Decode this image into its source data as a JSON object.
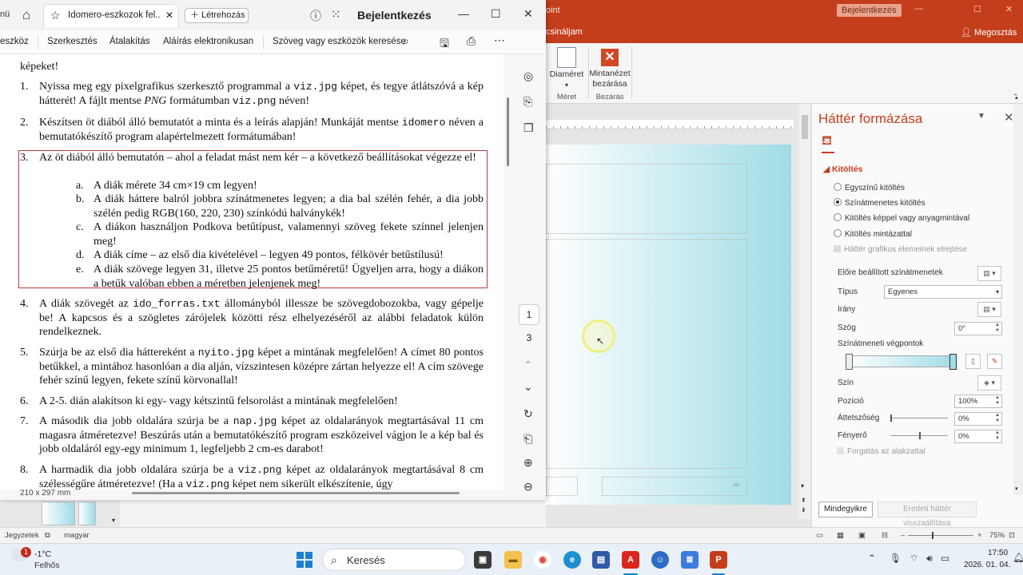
{
  "ppt": {
    "app_title_fragment": "oint",
    "signin_label": "Bejelentkezés",
    "menu_tab_fragment": "csináljam",
    "share_label": "Megosztás",
    "ribbon": {
      "size_label": "Diaméret",
      "close_master_label_1": "Mintanézet",
      "close_master_label_2": "bezárása",
      "group_size": "Méret",
      "group_close": "Bezárás"
    },
    "format_pane": {
      "title": "Háttér formázása",
      "section": "Kitöltés",
      "options": [
        "Egyszínű kitöltés",
        "Színátmenetes kitöltés",
        "Kitöltés képpel vagy anyagmintával",
        "Kitöltés mintázattal"
      ],
      "selected_option": "Színátmenetes kitöltés",
      "hide_graphics": "Háttér grafikus elemeinek elrejtése",
      "preset_label": "Előre beállított színátmenetek",
      "type_label": "Típus",
      "type_value": "Egyenes",
      "direction_label": "Irány",
      "angle_label": "Szög",
      "angle_value": "0°",
      "stops_label": "Színátmeneti végpontok",
      "color_label": "Szín",
      "position_label": "Pozíció",
      "position_value": "100%",
      "transparency_label": "Áttetszőség",
      "transparency_value": "0%",
      "brightness_label": "Fényerő",
      "brightness_value": "0%",
      "rotate_label": "Forgatás az alakzattal",
      "apply_all": "Mindegyikre",
      "reset_bg": "Eredeti háttér visszaállítása"
    },
    "status": {
      "notes": "Jegyzetek",
      "language": "magyar",
      "zoom": "75%"
    },
    "slide_gradient": {
      "from": "#ffffff",
      "to": "#a0dce6"
    }
  },
  "pdf": {
    "tab_title": "Idomero-eszkozok fel...",
    "create_label": "Létrehozás",
    "signin_label": "Bejelentkezés",
    "toolbar": {
      "tools_fragment": "eszköz",
      "edit": "Szerkesztés",
      "convert": "Átalakítás",
      "esign": "Aláírás elektronikusan",
      "search": "Szöveg vagy eszközök keresése"
    },
    "page_current": "1",
    "page_total": "3",
    "page_dims": "210 x 297 mm",
    "doc": {
      "top_fragment": "képeket!",
      "item1_a": "Nyissa meg egy pixelgrafikus szerkesztő programmal a ",
      "item1_code1": "viz.jpg",
      "item1_b": " képet, és tegye átlátszóvá a kép hátterét! A fájlt mentse ",
      "item1_em": "PNG",
      "item1_c": " formátumban ",
      "item1_code2": "viz.png",
      "item1_d": " néven!",
      "item2_a": "Készítsen öt diából álló bemutatót a minta és a leírás alapján! Munkáját mentse ",
      "item2_code": "idomero",
      "item2_b": " néven a bemutatókészítő program alapértelmezett formátumában!",
      "item3": "Az öt diából álló bemutatón – ahol a feladat mást nem kér – a következő beállításokat végezze el!",
      "item3a": "A diák mérete 34 cm×19 cm legyen!",
      "item3b": "A diák háttere balról jobbra színátmenetes legyen; a dia bal szélén fehér, a dia jobb szélén pedig RGB(160, 220, 230) színkódú halványkék!",
      "item3c": "A diákon használjon Podkova betűtípust, valamennyi szöveg fekete színnel jelenjen meg!",
      "item3d": "A diák címe – az első dia kivételével – legyen 49 pontos, félkövér betűstílusú!",
      "item3e": "A diák szövege legyen 31, illetve 25 pontos betűméretű! Ügyeljen arra, hogy a diákon a betűk valóban ebben a méretben jelenjenek meg!",
      "item4_a": "A diák szövegét az ",
      "item4_code": "ido_forras.txt",
      "item4_b": " állományból illessze be szövegdobozokba, vagy gépelje be! A kapcsos és a szögletes zárójelek közötti rész elhelyezéséről az alábbi feladatok külön rendelkeznek.",
      "item5_a": "Szúrja be az első dia háttereként a ",
      "item5_code": "nyito.jpg",
      "item5_b": " képet a mintának megfelelően! A címet 80 pontos betűkkel, a mintához hasonlóan a dia alján, vízszintesen középre zártan helyezze el! A cím szövege fehér színű legyen, fekete színű körvonallal!",
      "item6": "A 2-5. dián alakítson ki egy- vagy kétszintű felsorolást a mintának megfelelően!",
      "item7_a": "A második dia jobb oldalára szúrja be a ",
      "item7_code": "nap.jpg",
      "item7_b": " képet az oldalarányok megtartásával 11 cm magasra átméretezve! Beszúrás után a bemutatókészítő program eszközeivel vágjon le a kép bal és jobb oldaláról egy-egy minimum 1, legfeljebb 2 cm-es darabot!",
      "item8_a": "A harmadik dia jobb oldalára szúrja be a ",
      "item8_code1": "viz.png",
      "item8_b": " képet az oldalarányok megtartásával 8 cm szélességűre átméretezve! (Ha a ",
      "item8_code2": "viz.png",
      "item8_c": " képet nem sikerült elkészítenie, úgy"
    }
  },
  "taskbar": {
    "badge": "1",
    "temp": "-1°C",
    "condition": "Felhős",
    "search": "Keresés",
    "time": "17:50",
    "date": "2026. 01. 04."
  }
}
